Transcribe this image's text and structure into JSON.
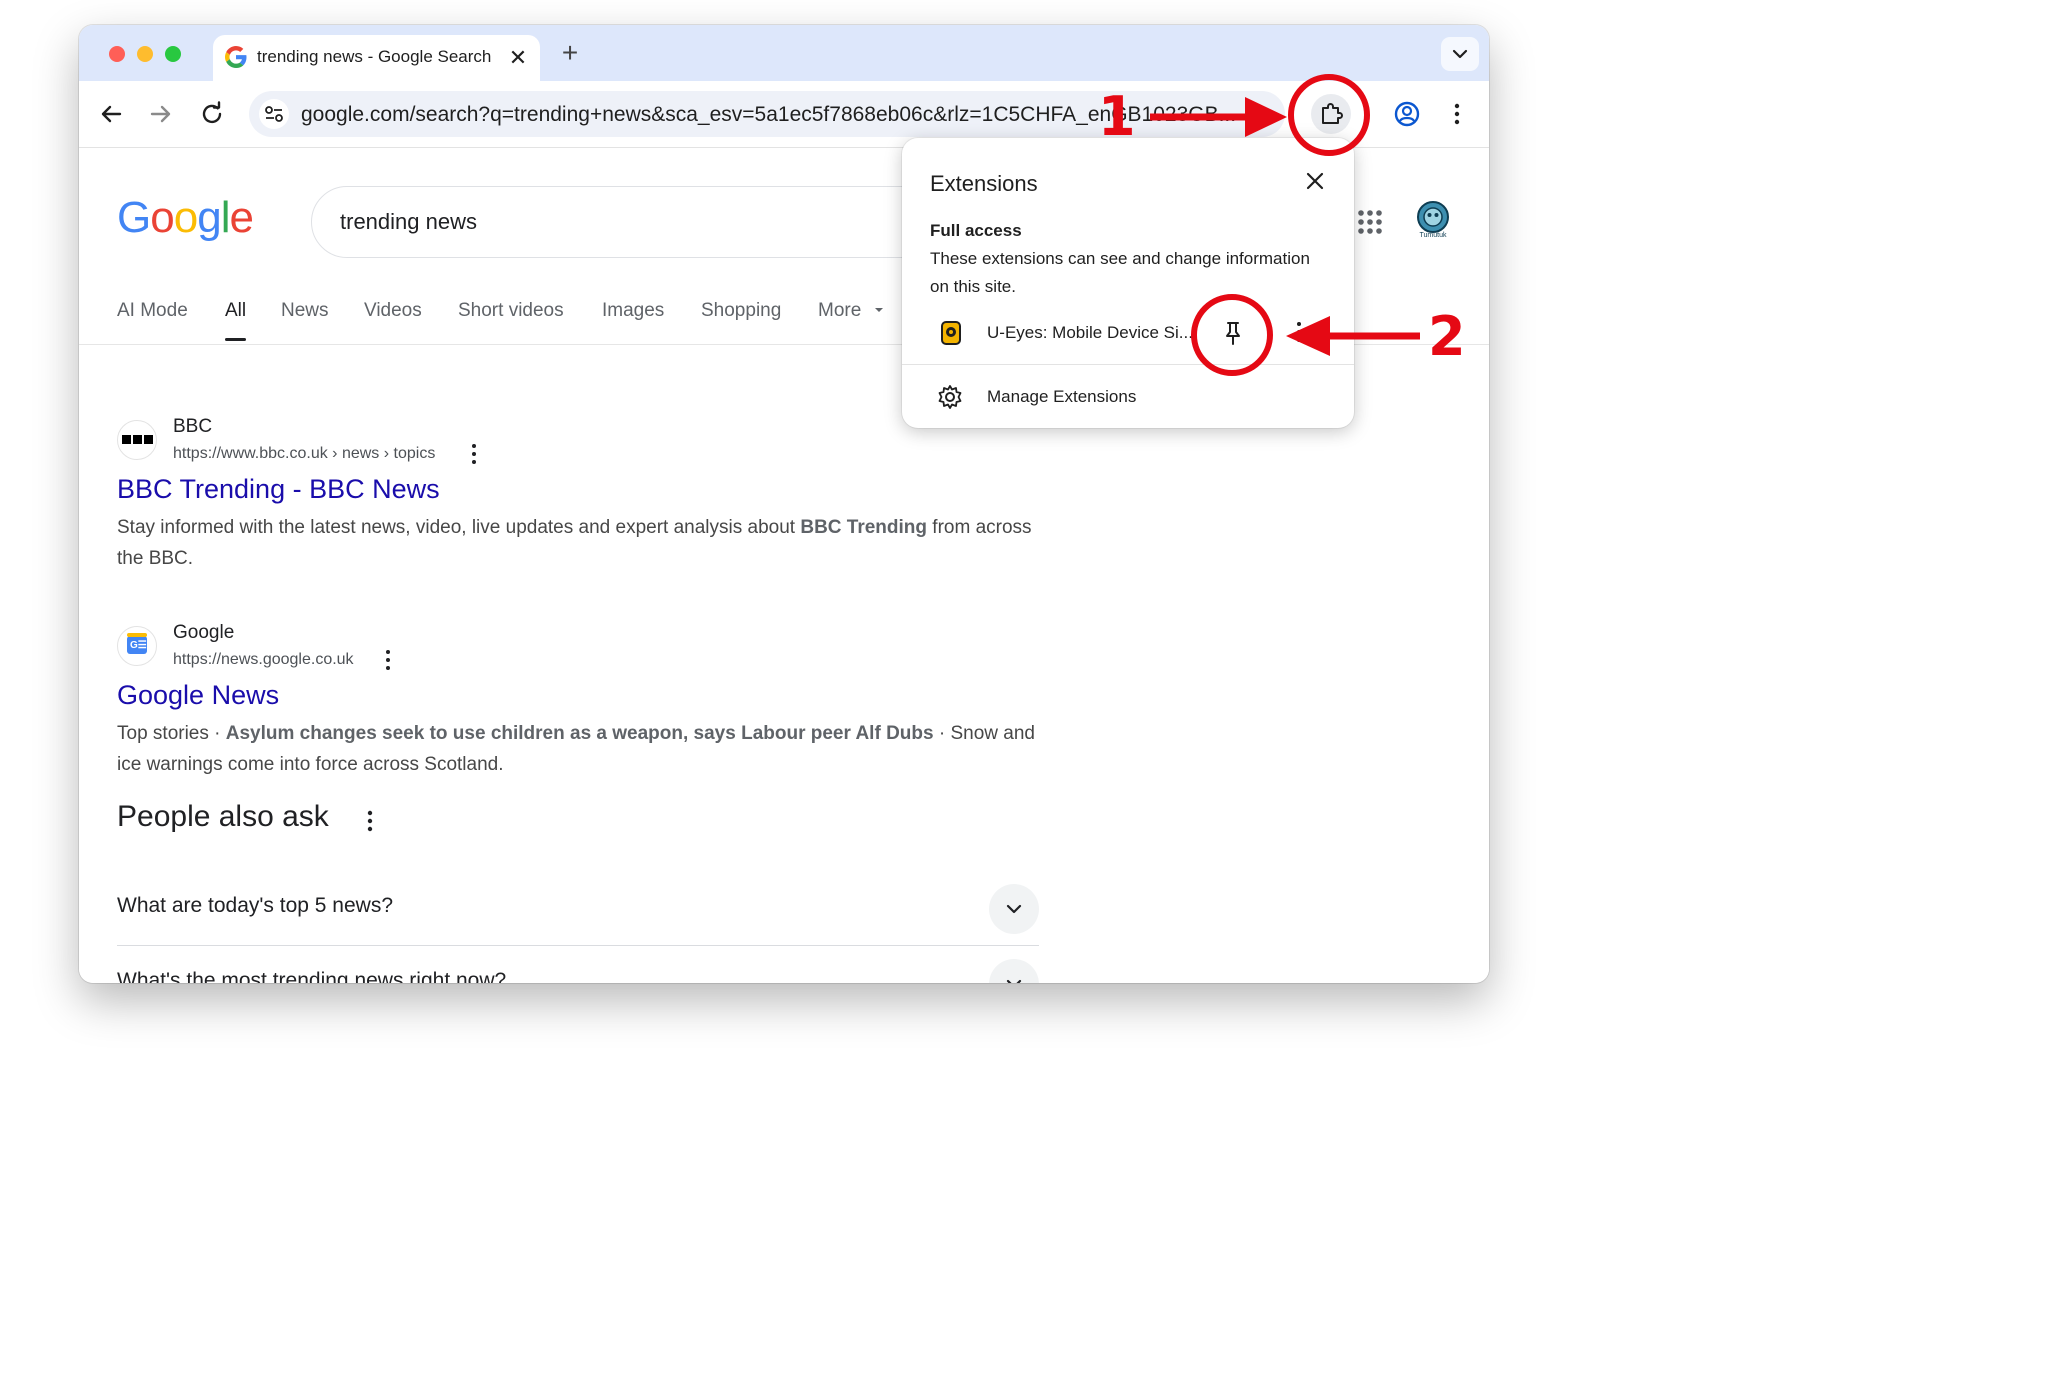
{
  "browser": {
    "tab_title": "trending news - Google Search",
    "new_tab_symbol": "+",
    "tab_close_symbol": "✕",
    "address_url": "google.com/search?q=trending+news&sca_esv=5a1ec5f7868eb06c&rlz=1C5CHFA_enGB1023GB..."
  },
  "google": {
    "logo_text": "Google",
    "query": "trending news",
    "account_label": "Tumutuk",
    "tabs": [
      {
        "label": "AI Mode"
      },
      {
        "label": "All"
      },
      {
        "label": "News"
      },
      {
        "label": "Videos"
      },
      {
        "label": "Short videos"
      },
      {
        "label": "Images"
      },
      {
        "label": "Shopping"
      },
      {
        "label": "More"
      }
    ]
  },
  "results": [
    {
      "site": "BBC",
      "cite": "https://www.bbc.co.uk › news › topics",
      "title": "BBC Trending - BBC News",
      "snippet_pre": "Stay informed with the latest news, video, live updates and expert analysis about ",
      "snippet_bold": "BBC Trending",
      "snippet_post": " from across the BBC."
    },
    {
      "site": "Google",
      "cite": "https://news.google.co.uk",
      "title": "Google News",
      "snippet_pre": "Top stories · ",
      "snippet_bold": "Asylum changes seek to use children as a weapon, says Labour peer Alf Dubs",
      "snippet_post": " · Snow and ice warnings come into force across Scotland."
    }
  ],
  "people_also_ask": {
    "heading": "People also ask",
    "questions": [
      "What are today's top 5 news?",
      "What's the most trending news right now?"
    ]
  },
  "extensions_popup": {
    "title": "Extensions",
    "section": "Full access",
    "description": "These extensions can see and change information on this site.",
    "extension_name": "U-Eyes: Mobile Device Si...",
    "manage_label": "Manage Extensions"
  },
  "annotations": {
    "step1": "1",
    "step2": "2",
    "color": "#e50914"
  }
}
